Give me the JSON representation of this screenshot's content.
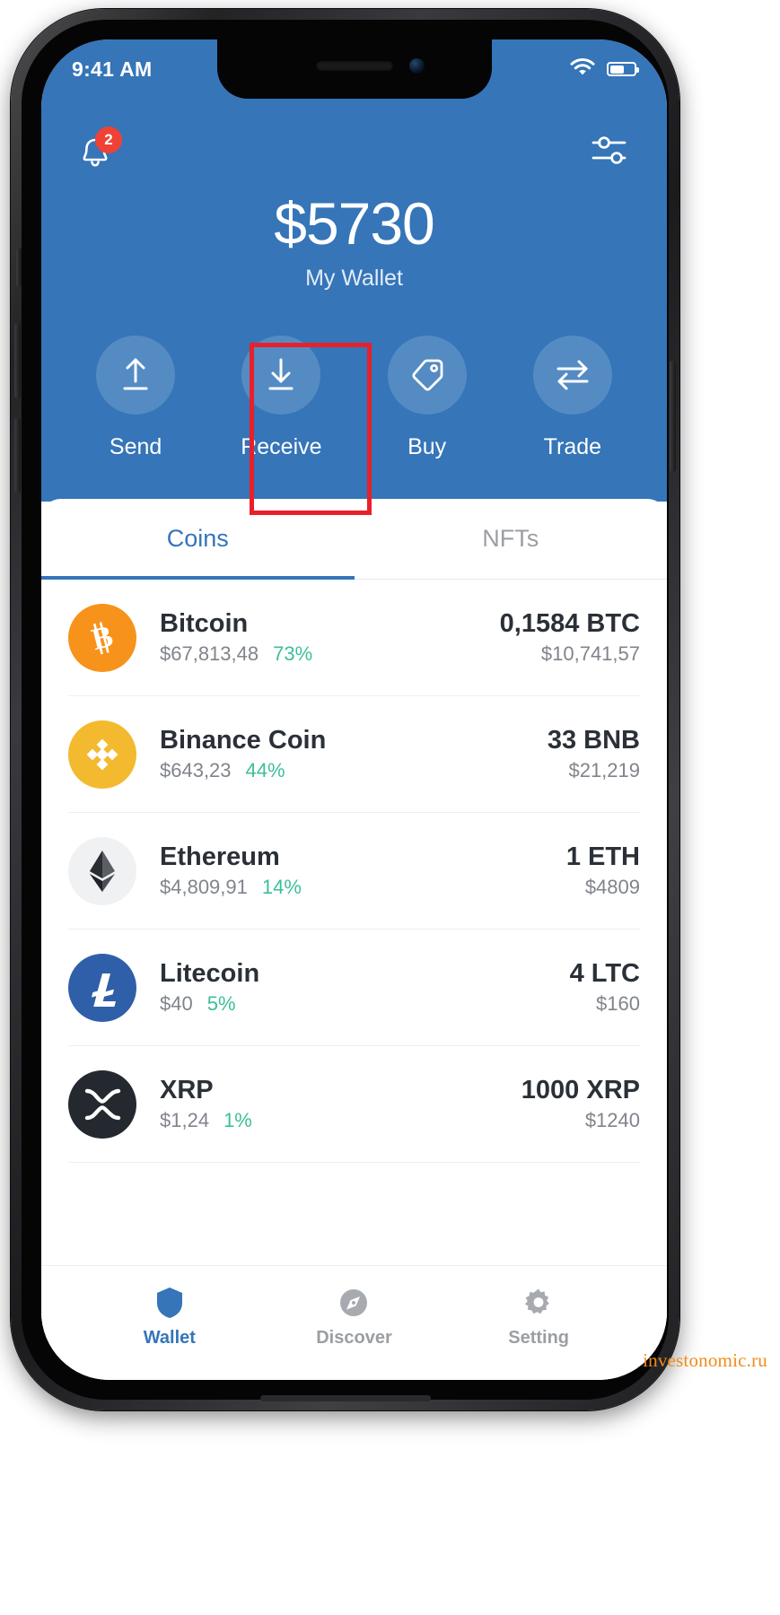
{
  "status_bar": {
    "time": "9:41 AM",
    "wifi_icon": "wifi-icon",
    "battery_icon": "battery-icon",
    "battery_level": 55
  },
  "header": {
    "notification_icon": "bell-icon",
    "notification_count": "2",
    "settings_icon": "sliders-icon",
    "balance": "$5730",
    "wallet_label": "My Wallet",
    "accent_color": "#3575b8",
    "highlight_color": "#e8202a"
  },
  "actions": [
    {
      "label": "Send",
      "icon": "upload-arrow-icon"
    },
    {
      "label": "Receive",
      "icon": "download-arrow-icon",
      "highlighted": true
    },
    {
      "label": "Buy",
      "icon": "price-tag-icon"
    },
    {
      "label": "Trade",
      "icon": "swap-arrows-icon"
    }
  ],
  "tabs": [
    {
      "label": "Coins",
      "active": true
    },
    {
      "label": "NFTs",
      "active": false
    }
  ],
  "coins": [
    {
      "name": "Bitcoin",
      "symbol": "BTC",
      "icon": "bitcoin-icon",
      "icon_color": "#f7931a",
      "price": "$67,813,48",
      "change_pct": "73%",
      "amount": "0,1584 BTC",
      "value": "$10,741,57"
    },
    {
      "name": "Binance Coin",
      "symbol": "BNB",
      "icon": "binance-icon",
      "icon_color": "#f3ba2f",
      "price": "$643,23",
      "change_pct": "44%",
      "amount": "33 BNB",
      "value": "$21,219"
    },
    {
      "name": "Ethereum",
      "symbol": "ETH",
      "icon": "ethereum-icon",
      "icon_color": "#f0f1f3",
      "price": "$4,809,91",
      "change_pct": "14%",
      "amount": "1 ETH",
      "value": "$4809"
    },
    {
      "name": "Litecoin",
      "symbol": "LTC",
      "icon": "litecoin-icon",
      "icon_color": "#2f5fa8",
      "price": "$40",
      "change_pct": "5%",
      "amount": "4 LTC",
      "value": "$160"
    },
    {
      "name": "XRP",
      "symbol": "XRP",
      "icon": "xrp-icon",
      "icon_color": "#23292f",
      "price": "$1,24",
      "change_pct": "1%",
      "amount": "1000 XRP",
      "value": "$1240"
    }
  ],
  "bottom_nav": [
    {
      "label": "Wallet",
      "icon": "shield-icon",
      "active": true
    },
    {
      "label": "Discover",
      "icon": "compass-icon",
      "active": false
    },
    {
      "label": "Setting",
      "icon": "gear-icon",
      "active": false
    }
  ],
  "watermark": {
    "text": "investonomic.ru",
    "color": "#f08c1a"
  },
  "change_color": "#3cbf9a"
}
